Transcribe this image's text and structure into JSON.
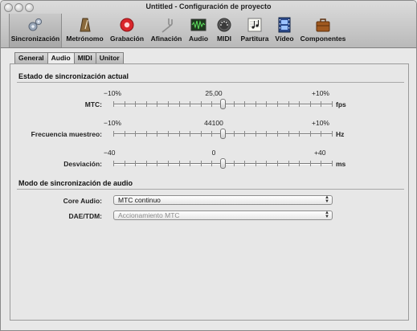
{
  "window": {
    "title": "Untitled - Configuración de proyecto"
  },
  "toolbar": {
    "items": [
      {
        "label": "Sincronización",
        "icon": "gears-icon"
      },
      {
        "label": "Metrónomo",
        "icon": "metronome-icon"
      },
      {
        "label": "Grabación",
        "icon": "record-icon"
      },
      {
        "label": "Afinación",
        "icon": "tuning-fork-icon"
      },
      {
        "label": "Audio",
        "icon": "audio-waveform-icon"
      },
      {
        "label": "MIDI",
        "icon": "midi-connector-icon"
      },
      {
        "label": "Partitura",
        "icon": "score-icon"
      },
      {
        "label": "Vídeo",
        "icon": "film-icon"
      },
      {
        "label": "Componentes",
        "icon": "briefcase-icon"
      }
    ]
  },
  "tabs": [
    "General",
    "Audio",
    "MIDI",
    "Unitor"
  ],
  "selected_tab": "Audio",
  "sync_status": {
    "heading": "Estado de sincronización actual",
    "rows": [
      {
        "label": "MTC:",
        "min": "−10%",
        "center": "25,00",
        "max": "+10%",
        "unit": "fps",
        "level": 0.5
      },
      {
        "label": "Frecuencia muestreo:",
        "min": "−10%",
        "center": "44100",
        "max": "+10%",
        "unit": "Hz",
        "level": 0.5
      },
      {
        "label": "Desviación:",
        "min": "−40",
        "center": "0",
        "max": "+40",
        "unit": "ms",
        "level": 0.5
      }
    ]
  },
  "audio_sync": {
    "heading": "Modo de sincronización de audio",
    "core_audio": {
      "label": "Core Audio:",
      "value": "MTC continuo"
    },
    "dae_tdm": {
      "label": "DAE/TDM:",
      "value": "Accionamiento MTC"
    }
  }
}
